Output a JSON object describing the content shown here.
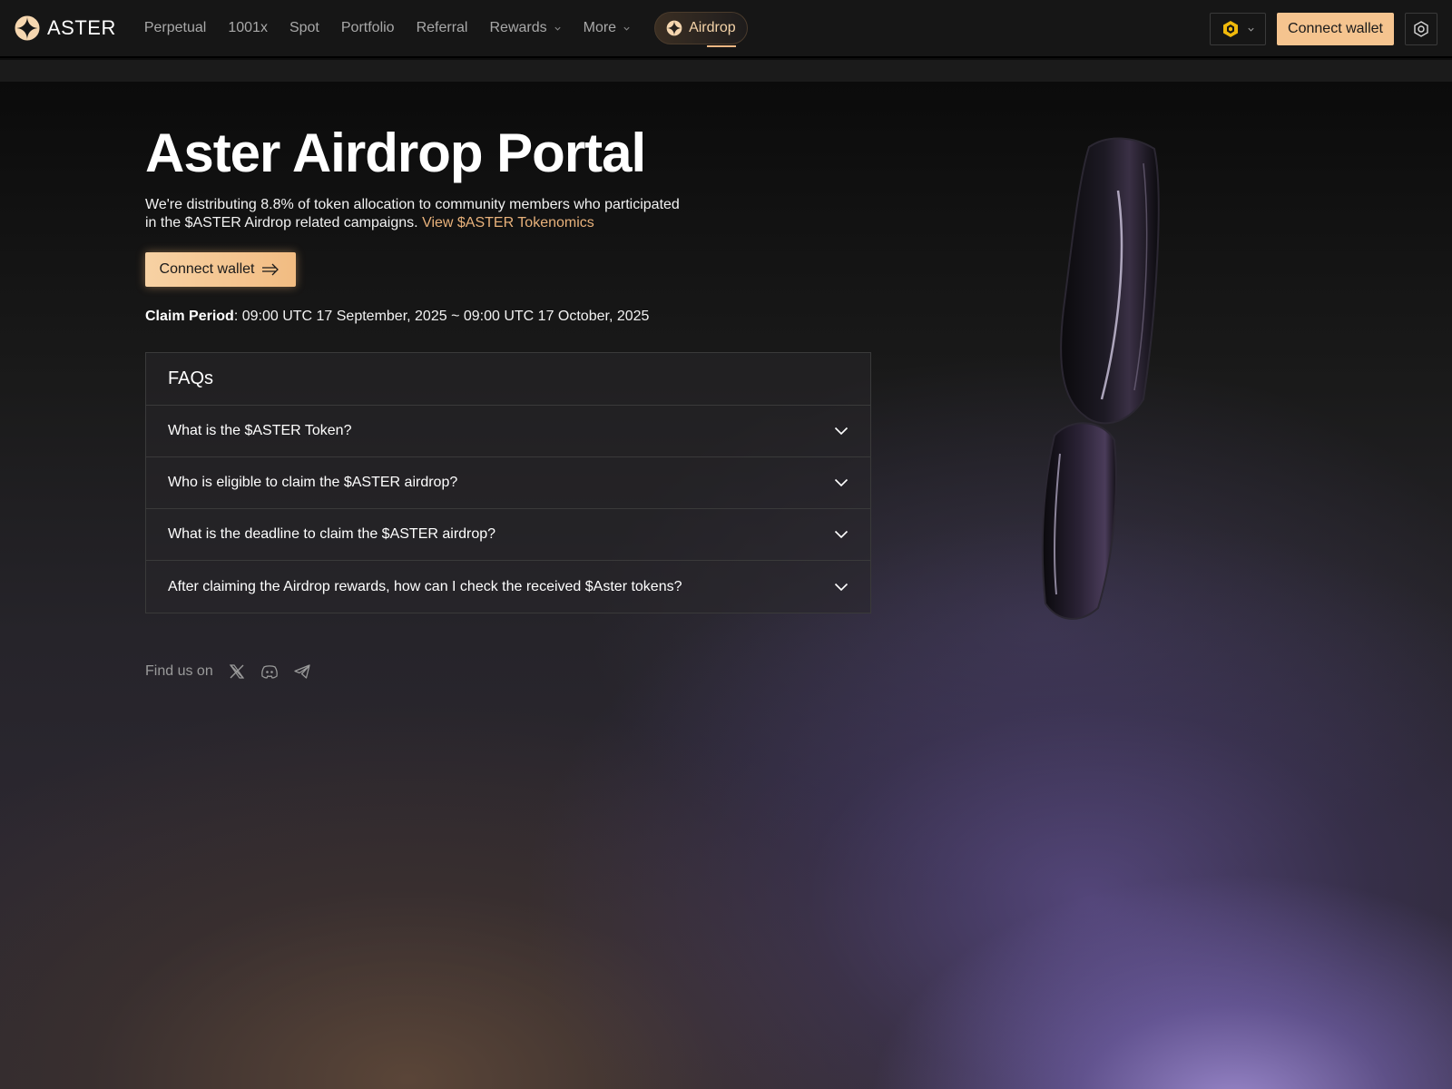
{
  "nav": {
    "brand": "ASTER",
    "links": [
      "Perpetual",
      "1001x",
      "Spot",
      "Portfolio",
      "Referral",
      "Rewards",
      "More"
    ],
    "airdrop": "Airdrop",
    "connect": "Connect wallet",
    "chain_icon": "bnb-chain-icon",
    "settings_icon": "settings-icon"
  },
  "hero": {
    "title": "Aster Airdrop Portal",
    "intro": "We're distributing 8.8% of token allocation to community members who participated in the $ASTER Airdrop related campaigns.",
    "tokenomics_link": "View $ASTER Tokenomics",
    "connect": "Connect wallet",
    "claim_label": "Claim Period",
    "claim_value": ": 09:00 UTC 17 September, 2025 ~ 09:00 UTC 17 October, 2025"
  },
  "faq": {
    "title": "FAQs",
    "items": [
      "What is the $ASTER Token?",
      "Who is eligible to claim the $ASTER airdrop?",
      "What is the deadline to claim the $ASTER airdrop?",
      "After claiming the Airdrop rewards, how can I check the received $Aster tokens?"
    ]
  },
  "social": {
    "label": "Find us on",
    "icons": [
      "x-icon",
      "discord-icon",
      "telegram-icon"
    ]
  },
  "colors": {
    "accent": "#f5c48f",
    "link": "#e9b27b",
    "nav_bg": "#161616"
  }
}
